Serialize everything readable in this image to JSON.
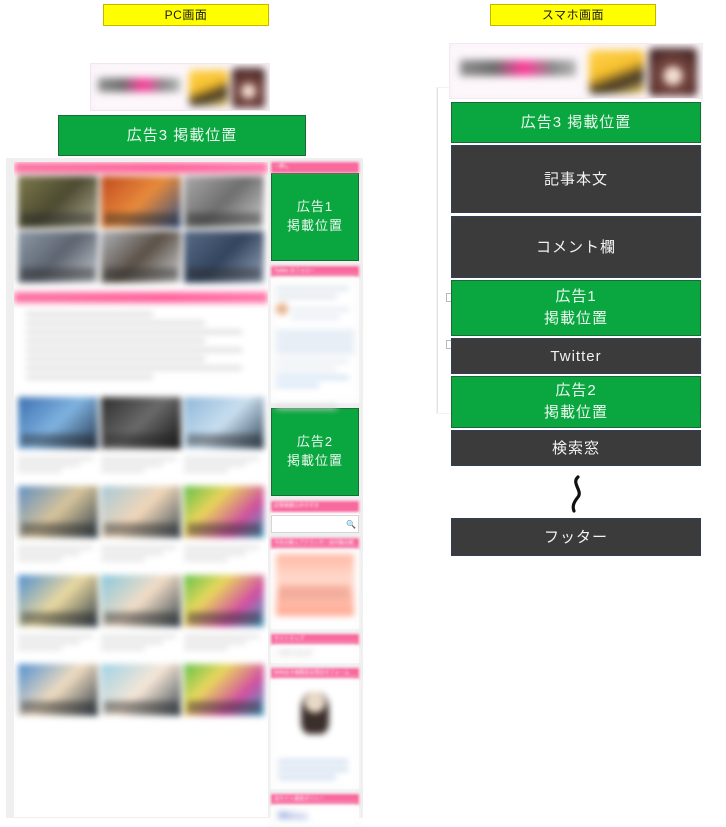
{
  "captions": {
    "pc": "PC画面",
    "sp": "スマホ画面"
  },
  "colors": {
    "ad_green": "#0aa63f",
    "block_dark": "#3b3b3b",
    "caption_yellow": "#ffff00",
    "widget_pink": "#f8699d",
    "page_grey": "#efefef"
  },
  "pc": {
    "banner_alt": "site-logo-banner",
    "ad3_label": "広告3 掲載位置",
    "sidebar": {
      "widgets": [
        {
          "title": "一押し",
          "type": "ad"
        },
        {
          "title": "Twitter のフォロー",
          "type": "embed"
        },
        {
          "title": "広告2",
          "type": "ad"
        },
        {
          "title": "記事検索ロボ子ずき",
          "type": "search"
        },
        {
          "title": "今年の新人アナウンサー全印象比較",
          "type": "thumbnail"
        },
        {
          "title": "サイトマップ",
          "type": "links"
        },
        {
          "title": "NHKお子様限定お問合せフォーム",
          "type": "thumbnail"
        },
        {
          "title": "当サイト運営ポリシー",
          "type": "links"
        }
      ],
      "ad1_label_line1": "広告1",
      "ad1_label_line2": "掲載位置",
      "ad2_label_line1": "広告2",
      "ad2_label_line2": "掲載位置",
      "sitemap_link": "サイトマップ",
      "policy_link": "運営ポリシー",
      "search_icon": "search-icon"
    }
  },
  "sp": {
    "banner_alt": "site-logo-banner",
    "blocks": [
      {
        "id": "ad3",
        "label": "広告3 掲載位置",
        "style": "green"
      },
      {
        "id": "article",
        "label": "記事本文",
        "style": "dark"
      },
      {
        "id": "comment",
        "label": "コメント欄",
        "style": "dark"
      },
      {
        "id": "ad1",
        "label_line1": "広告1",
        "label_line2": "掲載位置",
        "style": "green"
      },
      {
        "id": "twitter",
        "label": "Twitter",
        "style": "dark"
      },
      {
        "id": "ad2",
        "label_line1": "広告2",
        "label_line2": "掲載位置",
        "style": "green"
      },
      {
        "id": "search",
        "label": "検索窓",
        "style": "dark"
      },
      {
        "id": "footer",
        "label": "フッター",
        "style": "dark"
      }
    ],
    "ad3_label": "広告3 掲載位置",
    "article_label": "記事本文",
    "comment_label": "コメント欄",
    "ad1_line1": "広告1",
    "ad1_line2": "掲載位置",
    "twitter_label": "Twitter",
    "ad2_line1": "広告2",
    "ad2_line2": "掲載位置",
    "search_label": "検索窓",
    "footer_label": "フッター",
    "squiggle_icon": "wavy-continuation-icon"
  }
}
